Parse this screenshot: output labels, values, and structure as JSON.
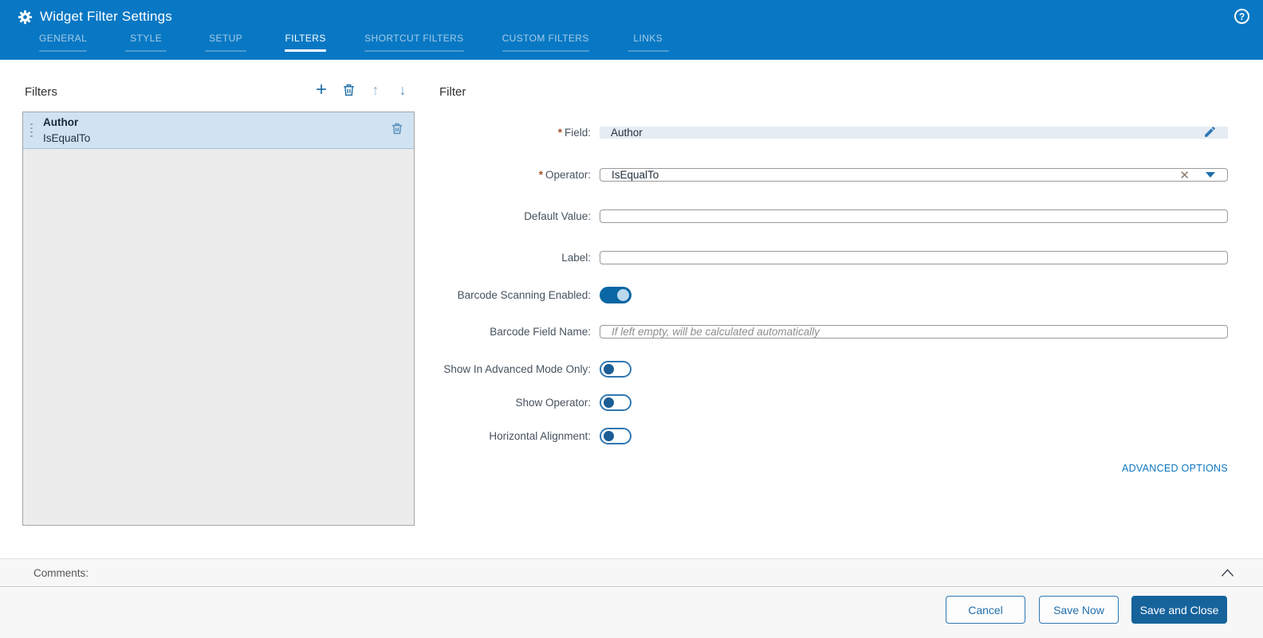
{
  "header": {
    "title": "Widget Filter Settings",
    "help_icon": "?",
    "tabs": [
      {
        "label": "GENERAL",
        "active": false
      },
      {
        "label": "STYLE",
        "active": false
      },
      {
        "label": "SETUP",
        "active": false
      },
      {
        "label": "FILTERS",
        "active": true
      },
      {
        "label": "SHORTCUT FILTERS",
        "active": false
      },
      {
        "label": "CUSTOM FILTERS",
        "active": false
      },
      {
        "label": "LINKS",
        "active": false
      }
    ]
  },
  "filters_panel": {
    "title": "Filters",
    "toolbar": {
      "add_icon": "+",
      "move_up_icon": "↑",
      "move_down_icon": "↓"
    },
    "items": [
      {
        "name": "Author",
        "operator": "IsEqualTo",
        "selected": true
      }
    ]
  },
  "filter_form": {
    "title": "Filter",
    "required_marker": "*",
    "field": {
      "label": "Field:",
      "required": true,
      "value": "Author"
    },
    "operator": {
      "label": "Operator:",
      "required": true,
      "value": "IsEqualTo",
      "clear_icon": "✕"
    },
    "default_value": {
      "label": "Default Value:",
      "value": "",
      "placeholder": ""
    },
    "label_field": {
      "label": "Label:",
      "value": "",
      "placeholder": ""
    },
    "barcode_scanning": {
      "label": "Barcode Scanning Enabled:",
      "on": true
    },
    "barcode_field_name": {
      "label": "Barcode Field Name:",
      "value": "",
      "placeholder": "If left empty, will be calculated automatically"
    },
    "advanced_mode": {
      "label": "Show In Advanced Mode Only:",
      "on": false
    },
    "show_operator": {
      "label": "Show Operator:",
      "on": false
    },
    "horizontal_alignment": {
      "label": "Horizontal Alignment:",
      "on": false
    },
    "advanced_options_label": "ADVANCED OPTIONS"
  },
  "comments": {
    "label": "Comments:"
  },
  "footer": {
    "cancel_label": "Cancel",
    "save_now_label": "Save Now",
    "save_and_close_label": "Save and Close"
  },
  "colors": {
    "header_blue": "#0878c4",
    "accent_blue": "#0b76c1",
    "icon_blue": "#1d6fa8",
    "selected_item_bg": "#cfe3f2",
    "toggle_on": "#0a66a4",
    "solid_button": "#16639c",
    "required_marker": "#a5502e"
  }
}
